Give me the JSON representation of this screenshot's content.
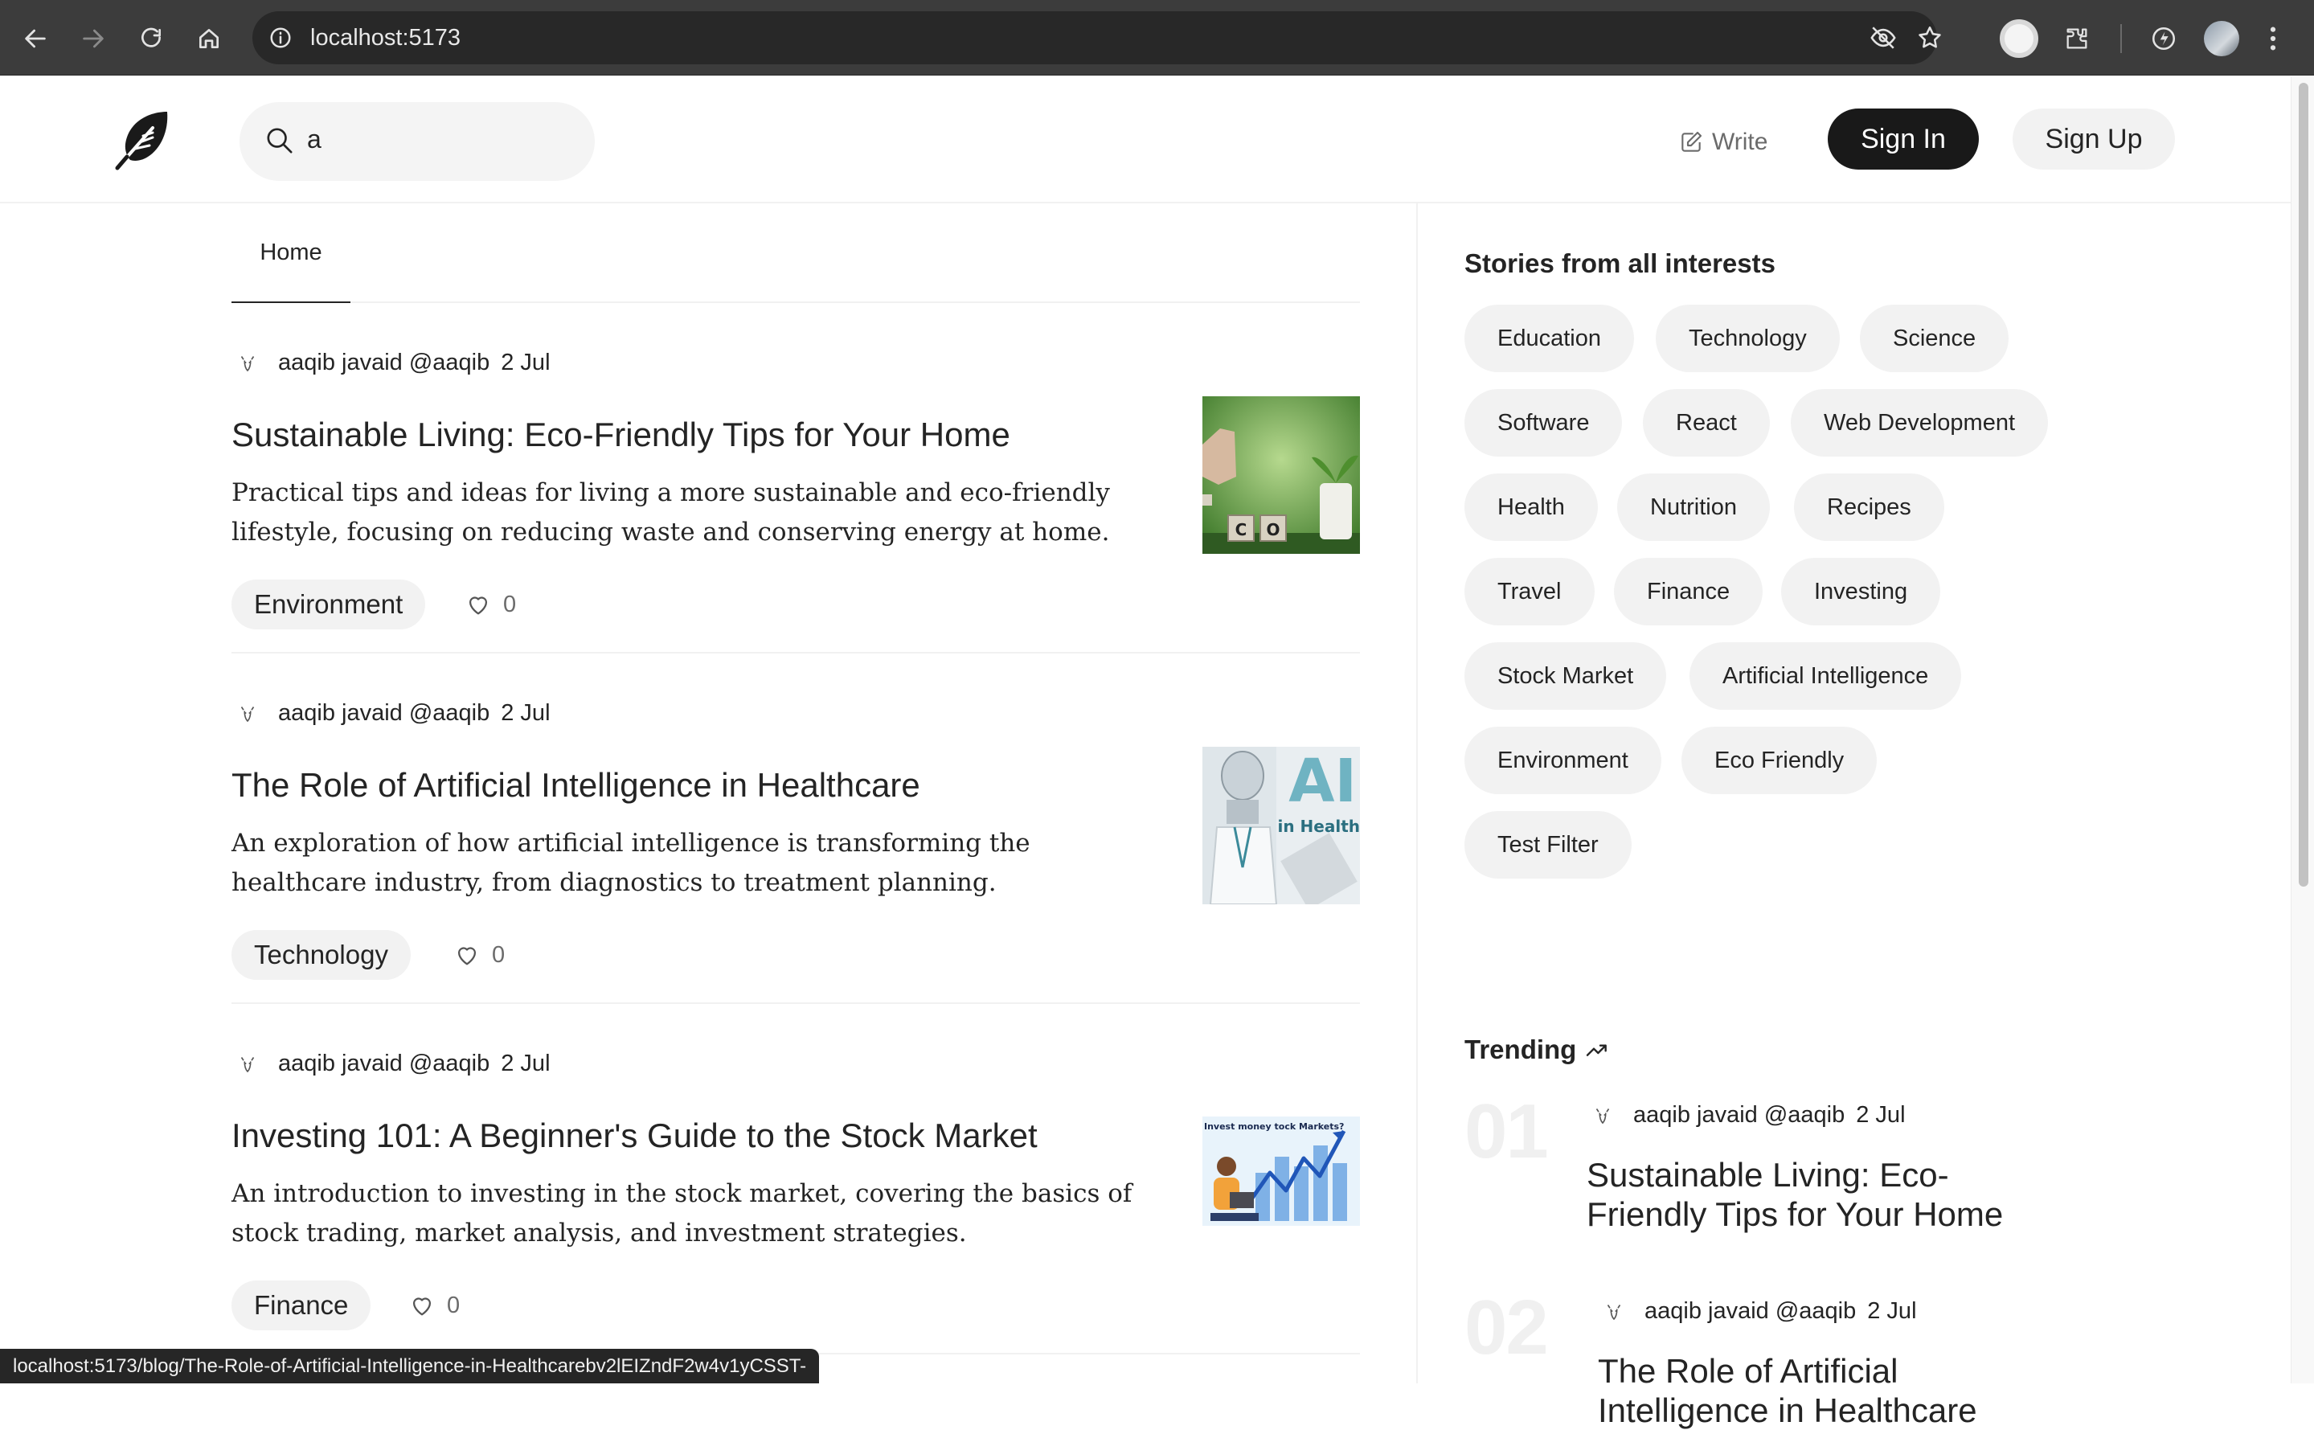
{
  "browser": {
    "url": "localhost:5173",
    "status_url": "localhost:5173/blog/The-Role-of-Artificial-Intelligence-in-Healthcarebv2lEIZndF2w4v1yCSST-"
  },
  "header": {
    "search_value": "a",
    "write_label": "Write",
    "sign_in_label": "Sign In",
    "sign_up_label": "Sign Up"
  },
  "tabs": {
    "home": "Home"
  },
  "posts": [
    {
      "author": "aaqib javaid @aaqib",
      "date": "2 Jul",
      "title": "Sustainable Living: Eco-Friendly Tips for Your Home",
      "excerpt": "Practical tips and ideas for living a more sustainable and eco-friendly lifestyle, focusing on reducing waste and conserving energy at home.",
      "tag": "Environment",
      "likes": "0",
      "image_caption": "C O"
    },
    {
      "author": "aaqib javaid @aaqib",
      "date": "2 Jul",
      "title": "The Role of Artificial Intelligence in Healthcare",
      "excerpt": "An exploration of how artificial intelligence is transforming the healthcare industry, from diagnostics to treatment planning.",
      "tag": "Technology",
      "likes": "0",
      "image_caption_big": "AI",
      "image_caption_small": "in Health"
    },
    {
      "author": "aaqib javaid @aaqib",
      "date": "2 Jul",
      "title": "Investing 101: A Beginner's Guide to the Stock Market",
      "excerpt": "An introduction to investing in the stock market, covering the basics of stock trading, market analysis, and investment strategies.",
      "tag": "Finance",
      "likes": "0",
      "image_caption": "Invest money tock Markets?"
    }
  ],
  "sidebar": {
    "heading": "Stories from all interests",
    "chips": [
      "Education",
      "Technology",
      "Science",
      "Software",
      "React",
      "Web Development",
      "Health",
      "Nutrition",
      "Recipes",
      "Travel",
      "Finance",
      "Investing",
      "Stock Market",
      "Artificial Intelligence",
      "Environment",
      "Eco Friendly",
      "Test Filter"
    ],
    "trending_heading": "Trending",
    "trending": [
      {
        "num": "01",
        "author": "aaqib javaid @aaqib",
        "date": "2 Jul",
        "title": "Sustainable Living: Eco-Friendly Tips for Your Home"
      },
      {
        "num": "02",
        "author": "aaqib javaid @aaqib",
        "date": "2 Jul",
        "title": "The Role of Artificial Intelligence in Healthcare"
      }
    ]
  },
  "colors": {
    "accent_dark": "#191919",
    "chip_bg": "#f2f2f2",
    "muted_text": "#6b6b6b"
  },
  "icons": [
    "back-icon",
    "forward-icon",
    "reload-icon",
    "home-icon",
    "site-info-icon",
    "eye-off-icon",
    "star-icon",
    "profile-icon",
    "extensions-icon",
    "performance-icon",
    "avatar-icon",
    "menu-icon",
    "feather-logo-icon",
    "search-icon",
    "write-icon",
    "heart-icon",
    "trending-icon"
  ]
}
